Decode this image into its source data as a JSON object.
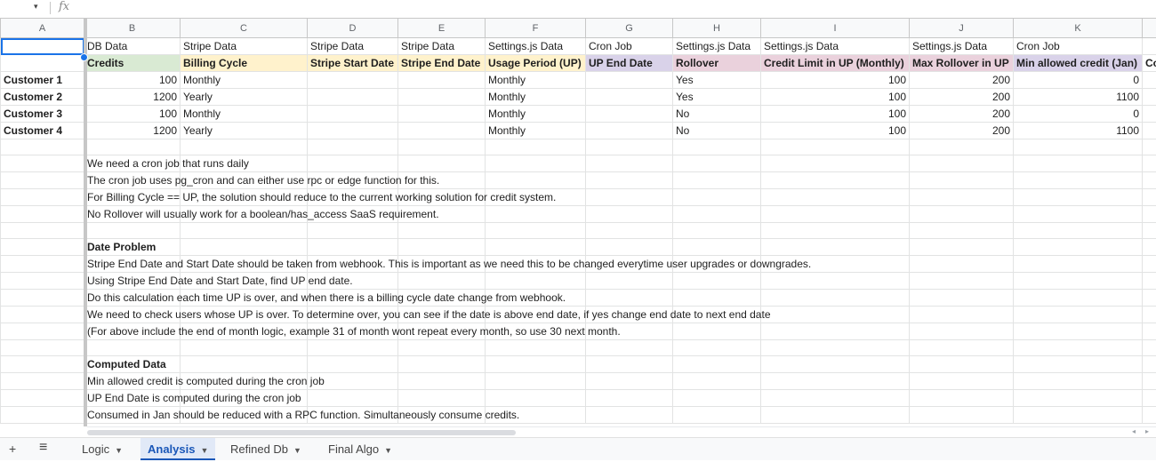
{
  "formula_bar": {
    "dropdown_glyph": "▾",
    "fx_label": "fx",
    "value": ""
  },
  "columns": [
    "A",
    "B",
    "C",
    "D",
    "E",
    "F",
    "G",
    "H",
    "I",
    "J",
    "K",
    ""
  ],
  "row_header_top": [
    "DB Data",
    "Stripe Data",
    "Stripe Data",
    "Stripe Data",
    "Settings.js Data",
    "Cron Job",
    "Settings.js Data",
    "Settings.js Data",
    "Settings.js Data",
    "Cron Job"
  ],
  "row_header_bold": [
    "Credits",
    "Billing Cycle",
    "Stripe Start Date",
    "Stripe End Date",
    "Usage Period (UP)",
    "UP End Date",
    "Rollover",
    "Credit Limit in UP (Monthly)",
    "Max Rollover in UP",
    "Min allowed credit (Jan)",
    "Co"
  ],
  "customers": [
    {
      "name": "Customer 1",
      "credits": "100",
      "cycle": "Monthly",
      "up": "Monthly",
      "rollover": "Yes",
      "limit": "100",
      "maxroll": "200",
      "min": "0"
    },
    {
      "name": "Customer 2",
      "credits": "1200",
      "cycle": "Yearly",
      "up": "Monthly",
      "rollover": "Yes",
      "limit": "100",
      "maxroll": "200",
      "min": "1100"
    },
    {
      "name": "Customer 3",
      "credits": "100",
      "cycle": "Monthly",
      "up": "Monthly",
      "rollover": "No",
      "limit": "100",
      "maxroll": "200",
      "min": "0"
    },
    {
      "name": "Customer 4",
      "credits": "1200",
      "cycle": "Yearly",
      "up": "Monthly",
      "rollover": "No",
      "limit": "100",
      "maxroll": "200",
      "min": "1100"
    }
  ],
  "notes": [
    {
      "text": "",
      "bold": false
    },
    {
      "text": "We need a cron job that runs daily",
      "bold": false
    },
    {
      "text": "The cron job uses pg_cron and can either use rpc or edge function for this.",
      "bold": false
    },
    {
      "text": "For Billing Cycle == UP, the solution should reduce to the current working solution for credit system.",
      "bold": false
    },
    {
      "text": "No Rollover will usually work for a boolean/has_access SaaS requirement.",
      "bold": false
    },
    {
      "text": "",
      "bold": false
    },
    {
      "text": "Date Problem",
      "bold": true
    },
    {
      "text": "Stripe End Date and Start Date should be taken from webhook. This is important as we need this to be changed everytime user upgrades or downgrades.",
      "bold": false
    },
    {
      "text": "Using Stripe End Date and Start Date, find UP end date.",
      "bold": false
    },
    {
      "text": "Do this calculation each time UP is over, and when there is a billing cycle date change from webhook.",
      "bold": false
    },
    {
      "text": "We need to check users whose UP is over. To determine over, you can see if the date is above end date, if yes change end date to next end date",
      "bold": false
    },
    {
      "text": "(For above include the end of month logic, example 31 of month wont repeat every month, so use 30 next month.",
      "bold": false
    },
    {
      "text": "",
      "bold": false
    },
    {
      "text": "Computed Data",
      "bold": true
    },
    {
      "text": "Min allowed credit is computed during the cron job",
      "bold": false
    },
    {
      "text": "UP End Date is computed during the cron job",
      "bold": false
    },
    {
      "text": "Consumed in Jan should be reduced with a RPC function. Simultaneously consume credits.",
      "bold": false
    }
  ],
  "sheet_tabs": [
    {
      "label": "Logic",
      "active": false
    },
    {
      "label": "Analysis",
      "active": true
    },
    {
      "label": "Refined Db",
      "active": false
    },
    {
      "label": "Final Algo",
      "active": false
    }
  ],
  "bottom_icons": {
    "add": "+",
    "menu": "≡"
  },
  "colors": {
    "green": "#d9ead3",
    "yellow": "#fff2cc",
    "purple": "#d9d2e9",
    "pink": "#ead1dc",
    "accent": "#1a73e8",
    "active_tab": "#1a57b8"
  }
}
